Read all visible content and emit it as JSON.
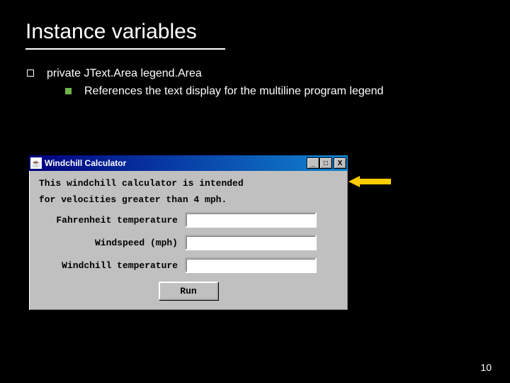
{
  "title": "Instance variables",
  "bullet": {
    "line1": "private JText.Area legend.Area",
    "line2": "References the text display for the multiline program legend"
  },
  "window": {
    "title": "Windchill Calculator",
    "min": "_",
    "max": "□",
    "close": "X",
    "legend1": "This windchill calculator is intended",
    "legend2": "for velocities greater than 4 mph.",
    "field1_label": "Fahrenheit temperature",
    "field2_label": "Windspeed (mph)",
    "field3_label": "Windchill temperature",
    "run": "Run"
  },
  "page_number": "10"
}
